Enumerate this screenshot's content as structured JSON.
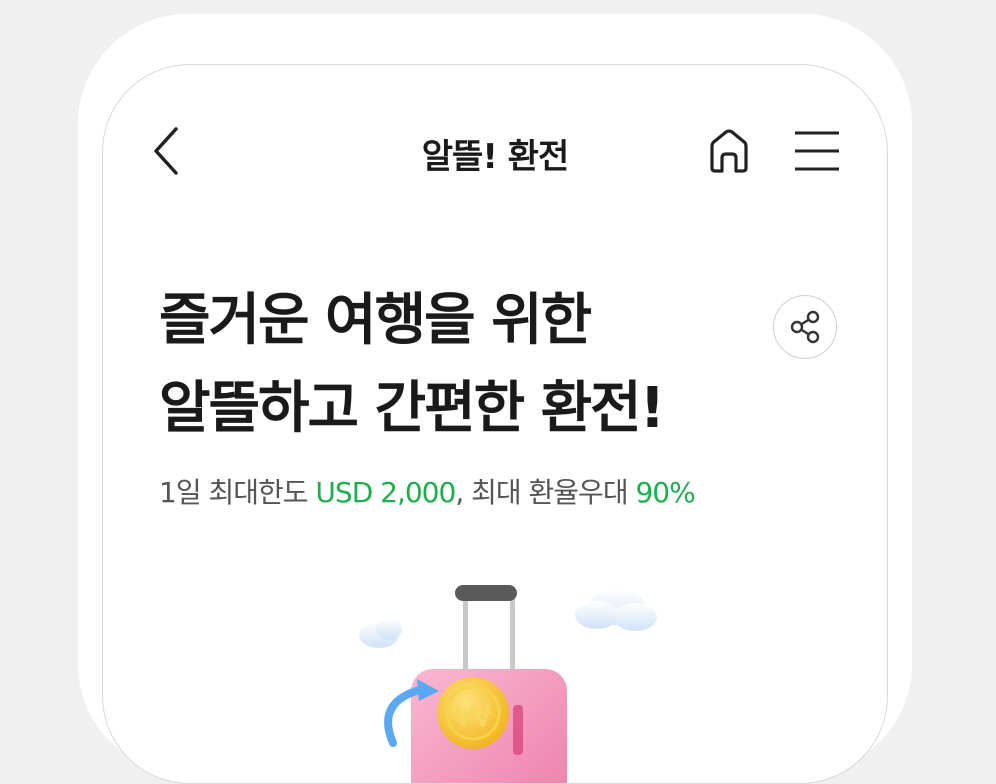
{
  "header": {
    "title": "알뜰! 환전",
    "back_icon": "chevron-left-icon",
    "home_icon": "home-icon",
    "menu_icon": "hamburger-menu-icon"
  },
  "hero": {
    "headline_line1": "즐거운 여행을 위한",
    "headline_line2": "알뜰하고 간편한 환전!",
    "share_icon": "share-icon",
    "subtext_prefix": "1일 최대한도 ",
    "subtext_limit": "USD 2,000",
    "subtext_middle": ", 최대 환율우대 ",
    "subtext_rate": "90%"
  },
  "illustration": {
    "name": "suitcase-with-coin-illustration"
  },
  "colors": {
    "accent_green": "#1fae4e",
    "text_dark": "#1a1a1a",
    "text_gray": "#555555",
    "suitcase_pink": "#f4a1c4",
    "coin_yellow": "#f7c531",
    "arrow_blue": "#5aa8f2"
  }
}
